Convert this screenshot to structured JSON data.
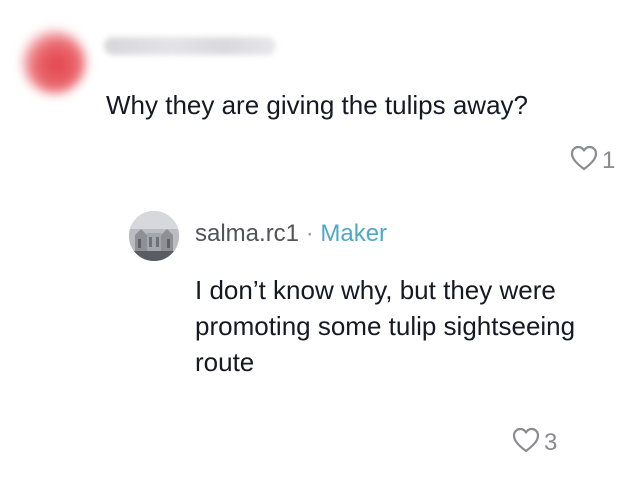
{
  "top_comment": {
    "text": "Why they are giving the tulips away?",
    "likes": "1"
  },
  "reply": {
    "username": "salma.rc1",
    "separator": " · ",
    "badge": "Maker",
    "text": "I don’t know why, but they were promoting some tulip sightseeing route",
    "likes": "3"
  },
  "icons": {
    "like": "heart-outline-icon"
  },
  "colors": {
    "text": "#161823",
    "muted": "#8a8b91",
    "badge": "#4fa9c6"
  }
}
